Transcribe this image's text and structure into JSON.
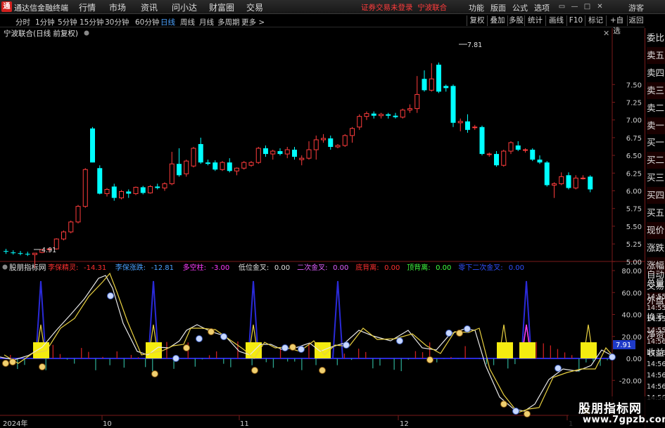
{
  "app": {
    "logo_glyph": "通",
    "name": "通达信金融终端",
    "menus": [
      "行情",
      "市场",
      "资讯",
      "问小达",
      "财富圈",
      "交易"
    ],
    "status": "证券交易未登录",
    "stock_short": "宁波联合",
    "right_menus": [
      "功能",
      "版面",
      "公式",
      "选项"
    ],
    "guest": "游客"
  },
  "periods": [
    "分时",
    "1分钟",
    "5分钟",
    "15分钟",
    "30分钟",
    "60分钟",
    "日线",
    "周线",
    "月线",
    "多周期",
    "更多 >"
  ],
  "active_period": "日线",
  "toolbar": [
    "复权",
    "叠加",
    "多股",
    "统计",
    "画线",
    "F10",
    "标记",
    "+自选",
    "返回"
  ],
  "chart": {
    "title": "宁波联合(日线 前复权)",
    "y_ticks": [
      "7.50",
      "7.25",
      "7.00",
      "6.75",
      "6.50",
      "6.25",
      "6.00",
      "5.75",
      "5.50",
      "5.25",
      "5.00"
    ],
    "high_label": "7.81",
    "low_label": "4.91",
    "candles": [
      [
        5.15,
        5.18,
        5.11,
        5.14
      ],
      [
        5.13,
        5.16,
        5.1,
        5.12
      ],
      [
        5.12,
        5.15,
        5.09,
        5.11
      ],
      [
        5.11,
        5.14,
        5.08,
        5.1
      ],
      [
        5.1,
        5.12,
        4.91,
        5.12
      ],
      [
        5.13,
        5.18,
        5.12,
        5.17
      ],
      [
        5.17,
        5.19,
        5.14,
        5.18
      ],
      [
        5.18,
        5.33,
        5.17,
        5.32
      ],
      [
        5.32,
        5.44,
        5.3,
        5.42
      ],
      [
        5.42,
        5.58,
        5.4,
        5.56
      ],
      [
        5.56,
        5.8,
        5.54,
        5.78
      ],
      [
        5.78,
        6.32,
        5.76,
        6.3
      ],
      [
        6.88,
        6.9,
        6.4,
        6.4
      ],
      [
        6.32,
        6.36,
        5.95,
        5.96
      ],
      [
        5.96,
        6.04,
        5.92,
        6.02
      ],
      [
        6.06,
        6.1,
        5.86,
        5.9
      ],
      [
        5.9,
        6.01,
        5.88,
        5.99
      ],
      [
        5.99,
        6.02,
        5.9,
        5.96
      ],
      [
        5.96,
        6.06,
        5.94,
        6.05
      ],
      [
        6.05,
        6.07,
        5.95,
        5.97
      ],
      [
        5.97,
        6.08,
        5.96,
        6.06
      ],
      [
        6.06,
        6.1,
        6.02,
        6.04
      ],
      [
        6.04,
        6.12,
        6.0,
        6.1
      ],
      [
        6.1,
        6.55,
        6.08,
        6.38
      ],
      [
        6.38,
        6.6,
        6.2,
        6.22
      ],
      [
        6.24,
        6.44,
        6.2,
        6.42
      ],
      [
        6.35,
        6.62,
        6.33,
        6.6
      ],
      [
        6.66,
        6.75,
        6.38,
        6.4
      ],
      [
        6.4,
        6.44,
        6.36,
        6.38
      ],
      [
        6.4,
        6.43,
        6.28,
        6.3
      ],
      [
        6.3,
        6.42,
        6.28,
        6.4
      ],
      [
        6.4,
        6.46,
        6.26,
        6.28
      ],
      [
        6.28,
        6.33,
        6.22,
        6.32
      ],
      [
        6.32,
        6.42,
        6.3,
        6.4
      ],
      [
        6.36,
        6.42,
        6.34,
        6.4
      ],
      [
        6.4,
        6.62,
        6.38,
        6.6
      ],
      [
        6.6,
        6.64,
        6.48,
        6.52
      ],
      [
        6.52,
        6.58,
        6.44,
        6.56
      ],
      [
        6.56,
        6.6,
        6.5,
        6.52
      ],
      [
        6.52,
        6.62,
        6.46,
        6.58
      ],
      [
        6.58,
        6.62,
        6.44,
        6.48
      ],
      [
        6.44,
        6.5,
        6.36,
        6.46
      ],
      [
        6.46,
        6.7,
        6.44,
        6.58
      ],
      [
        6.58,
        6.78,
        6.44,
        6.72
      ],
      [
        6.72,
        6.8,
        6.68,
        6.74
      ],
      [
        6.74,
        6.78,
        6.58,
        6.62
      ],
      [
        6.62,
        6.66,
        6.6,
        6.64
      ],
      [
        6.64,
        6.8,
        6.62,
        6.78
      ],
      [
        6.78,
        6.9,
        6.68,
        6.88
      ],
      [
        6.9,
        7.08,
        6.86,
        7.05
      ],
      [
        7.05,
        7.12,
        7.0,
        7.09
      ],
      [
        7.09,
        7.12,
        7.02,
        7.06
      ],
      [
        7.06,
        7.1,
        7.02,
        7.08
      ],
      [
        7.08,
        7.1,
        7.02,
        7.06
      ],
      [
        7.06,
        7.1,
        7.02,
        7.04
      ],
      [
        7.04,
        7.16,
        7.02,
        7.14
      ],
      [
        7.14,
        7.22,
        7.1,
        7.16
      ],
      [
        7.16,
        7.62,
        7.1,
        7.36
      ],
      [
        7.58,
        7.7,
        7.4,
        7.42
      ],
      [
        7.42,
        7.8,
        7.4,
        7.58
      ],
      [
        7.78,
        7.81,
        7.38,
        7.4
      ],
      [
        7.48,
        7.5,
        7.4,
        7.45
      ],
      [
        7.48,
        7.5,
        6.9,
        6.96
      ],
      [
        6.96,
        7.02,
        6.84,
        6.98
      ],
      [
        6.98,
        7.08,
        6.82,
        6.86
      ],
      [
        6.9,
        6.93,
        6.86,
        6.9
      ],
      [
        6.9,
        6.92,
        6.5,
        6.52
      ],
      [
        6.52,
        6.54,
        6.48,
        6.52
      ],
      [
        6.52,
        6.56,
        6.34,
        6.36
      ],
      [
        6.36,
        6.58,
        6.34,
        6.56
      ],
      [
        6.56,
        6.7,
        6.52,
        6.68
      ],
      [
        6.64,
        6.7,
        6.56,
        6.58
      ],
      [
        6.58,
        6.6,
        6.54,
        6.58
      ],
      [
        6.58,
        6.6,
        6.42,
        6.44
      ],
      [
        6.44,
        6.5,
        6.38,
        6.4
      ],
      [
        6.4,
        6.42,
        6.06,
        6.08
      ],
      [
        6.08,
        6.12,
        5.9,
        6.1
      ],
      [
        6.1,
        6.26,
        6.08,
        6.2
      ],
      [
        6.22,
        6.26,
        6.02,
        6.04
      ],
      [
        6.04,
        6.22,
        6.02,
        6.18
      ],
      [
        6.18,
        6.22,
        6.16,
        6.18
      ],
      [
        6.2,
        6.22,
        5.98,
        6.02
      ]
    ]
  },
  "indicator": {
    "name": "股朋指标网",
    "items": [
      [
        "李保精灵:",
        "-14.31",
        "#ff2f2f"
      ],
      [
        "李保涨跌:",
        "-12.81",
        "#4aa0ff"
      ],
      [
        "多空柱:",
        "-3.00",
        "#ff3cff"
      ],
      [
        "低位金叉:",
        "0.00",
        "#e0e0e0"
      ],
      [
        "二次金叉:",
        "0.00",
        "#e060ff"
      ],
      [
        "底背离:",
        "0.00",
        "#ff3030"
      ],
      [
        "顶背离:",
        "0.00",
        "#40ff40"
      ],
      [
        "零下二次金叉:",
        "0.00",
        "#3050ff"
      ]
    ],
    "y_ticks": [
      "80.00",
      "60.00",
      "40.00",
      "20.00",
      "0.00",
      "-20.00"
    ],
    "value_tag": "7.91"
  },
  "xaxis": {
    "labels": [
      "2024年",
      "10",
      "11",
      "12",
      "1"
    ]
  },
  "sidebar": {
    "items": [
      "委比",
      "卖五",
      "卖四",
      "卖三",
      "卖二",
      "卖一",
      "买一",
      "买二",
      "买三",
      "买四",
      "买五",
      "现价",
      "涨跌",
      "涨幅",
      "总量",
      "外盘",
      "换手",
      "净资",
      "收益"
    ],
    "bottom": [
      "自动",
      "交易",
      "14:55",
      "14:55",
      "14:55",
      "14:55",
      "14:56",
      "14:56",
      "14:56",
      "14:56",
      "14:56",
      "14:56"
    ]
  },
  "watermark": {
    "line1": "股朋指标网",
    "line2": "www.7gpzb.com"
  },
  "colors": {
    "up": "#ff3c3c",
    "down": "#00ffff",
    "ma_white": "#e8e8e8",
    "ma_yellow": "#e8d040",
    "spike": "#2a2ad8",
    "marker": "#f4ec10"
  }
}
